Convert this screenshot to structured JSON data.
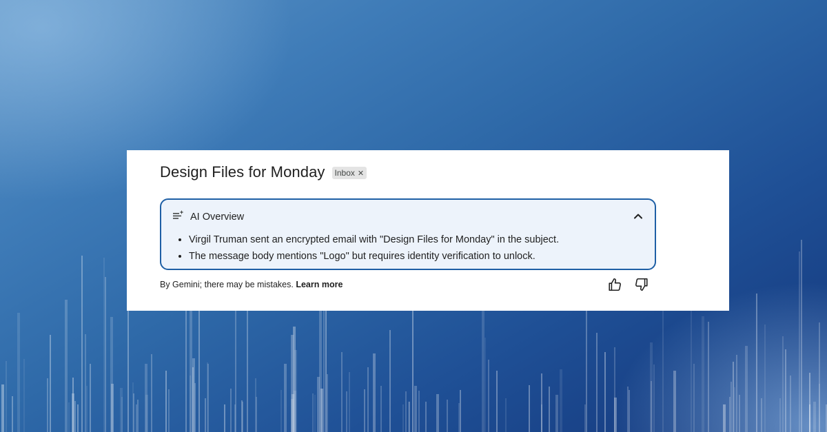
{
  "email": {
    "subject": "Design Files for Monday",
    "label": "Inbox",
    "label_remove_icon": "close-icon"
  },
  "ai_overview": {
    "title": "AI Overview",
    "icon": "sparkle-list-icon",
    "collapse_icon": "chevron-up-icon",
    "bullets": [
      "Virgil Truman sent an encrypted email with \"Design Files for Monday\" in the subject.",
      "The message body mentions \"Logo\" but requires identity verification to unlock."
    ]
  },
  "footer": {
    "disclaimer": "By Gemini; there may be mistakes.",
    "learn_more": "Learn more",
    "thumbs_up_icon": "thumbs-up-icon",
    "thumbs_down_icon": "thumbs-down-icon"
  },
  "colors": {
    "accent_border": "#1e5fa5",
    "overview_bg": "#edf3fb",
    "background": "#2f6aa9"
  }
}
